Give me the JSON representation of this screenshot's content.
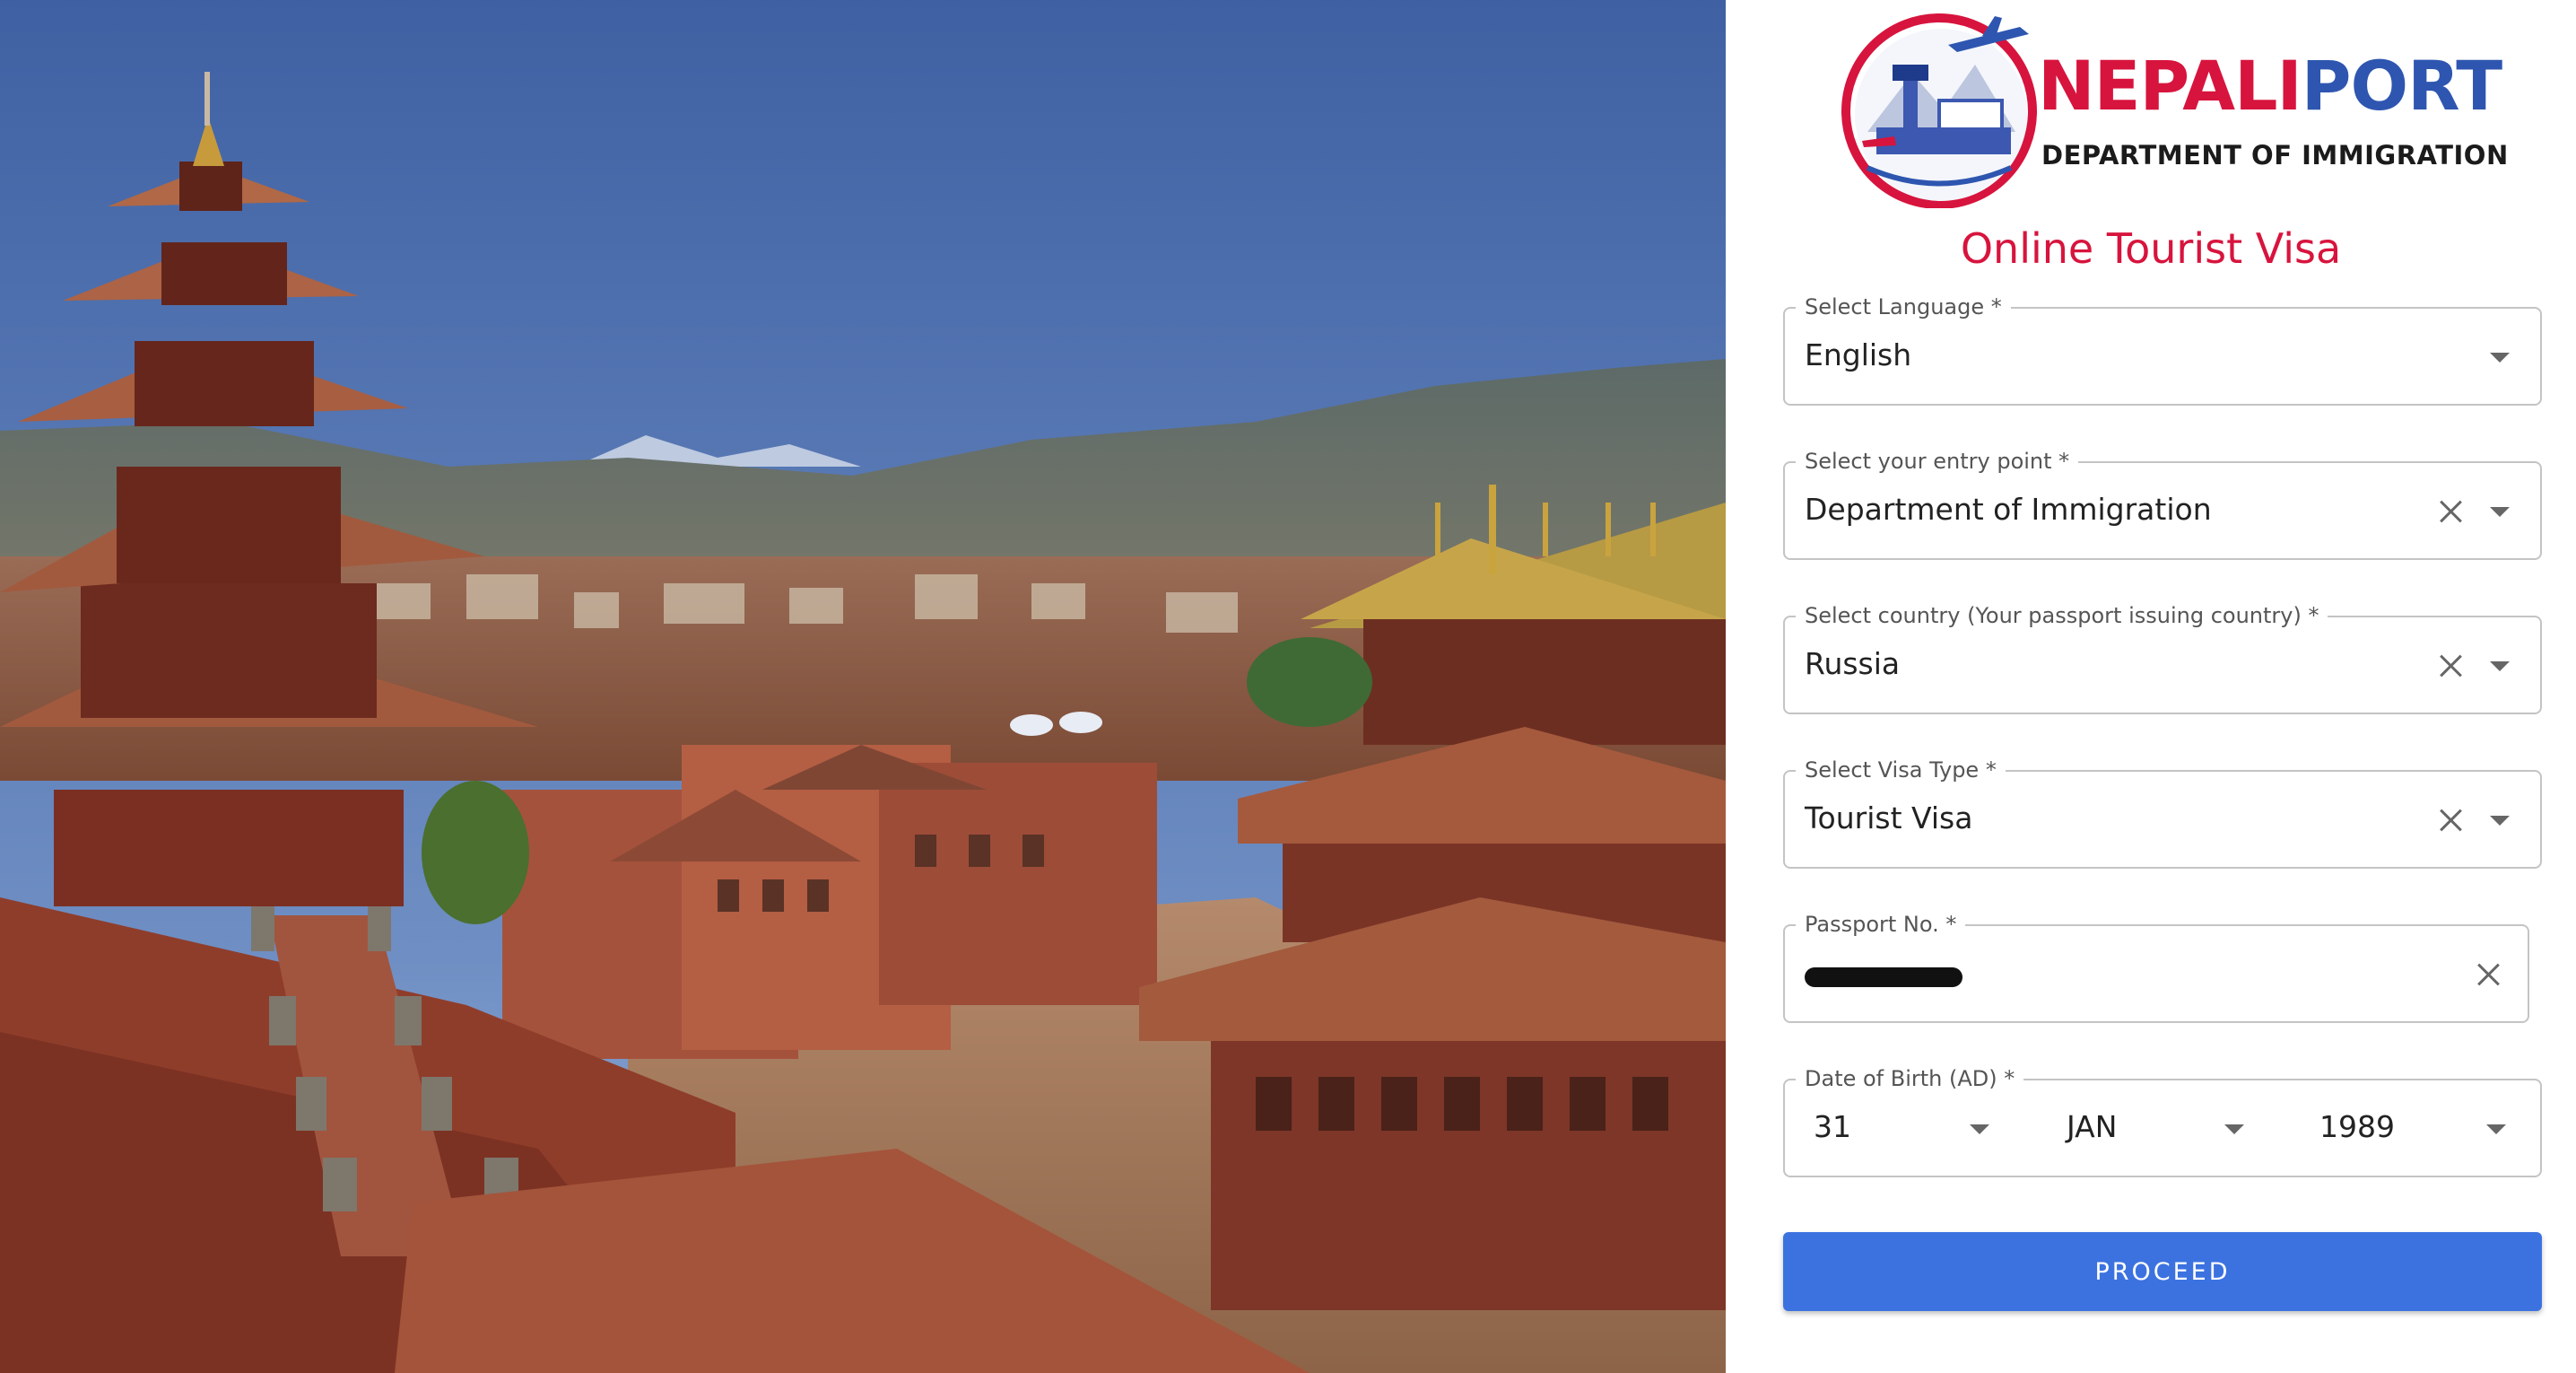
{
  "brand": {
    "name_part1": "NEPALI",
    "name_part2": "PORT",
    "subtitle": "DEPARTMENT OF IMMIGRATION"
  },
  "form": {
    "title": "Online Tourist Visa",
    "fields": [
      {
        "label": "Select Language *",
        "value": "English",
        "clearable": false
      },
      {
        "label": "Select your entry point *",
        "value": "Department of Immigration",
        "clearable": true
      },
      {
        "label": "Select country (Your passport issuing country) *",
        "value": "Russia",
        "clearable": true
      },
      {
        "label": "Select Visa Type *",
        "value": "Tourist Visa",
        "clearable": true
      },
      {
        "label": "Passport No. *",
        "value_redacted": true,
        "clearable": true
      }
    ],
    "dob": {
      "label": "Date of Birth (AD) *",
      "day": "31",
      "month": "JAN",
      "year": "1989"
    },
    "submit_label": "PROCEED"
  },
  "colors": {
    "brand_red": "#d7143d",
    "brand_blue": "#2e56b0",
    "button_blue": "#3c72e0"
  }
}
